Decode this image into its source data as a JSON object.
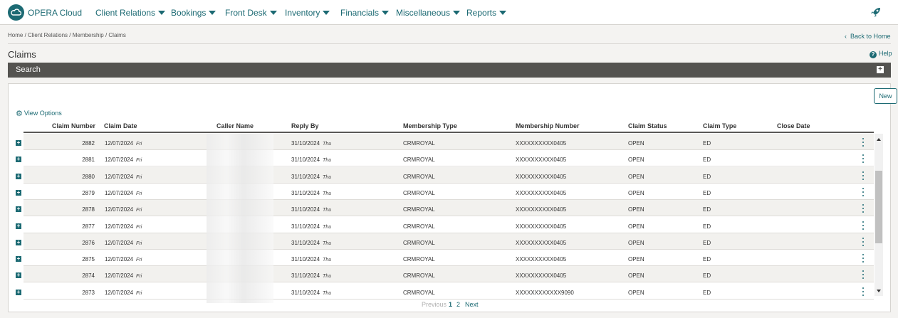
{
  "app": {
    "brand": "OPERA Cloud"
  },
  "nav": [
    {
      "label": "Client Relations"
    },
    {
      "label": "Bookings"
    },
    {
      "label": "Front Desk"
    },
    {
      "label": "Inventory"
    },
    {
      "label": "Financials"
    },
    {
      "label": "Miscellaneous"
    },
    {
      "label": "Reports"
    }
  ],
  "breadcrumb": "Home / Client Relations / Membership / Claims",
  "back_link": "Back to Home",
  "page_title": "Claims",
  "help_label": "Help",
  "search_panel": {
    "label": "Search"
  },
  "new_button": "New",
  "view_options": "View Options",
  "columns": [
    "Claim Number",
    "Claim Date",
    "Caller Name",
    "Reply By",
    "Membership Type",
    "Membership Number",
    "Claim Status",
    "Claim Type",
    "Close Date"
  ],
  "rows": [
    {
      "claim_number": "2882",
      "claim_date": "12/07/2024",
      "claim_day": "Fri",
      "reply_by": "31/10/2024",
      "reply_day": "Thu",
      "membership_type": "CRMROYAL",
      "membership_number": "XXXXXXXXXX0405",
      "status": "OPEN",
      "type": "ED",
      "close_date": ""
    },
    {
      "claim_number": "2881",
      "claim_date": "12/07/2024",
      "claim_day": "Fri",
      "reply_by": "31/10/2024",
      "reply_day": "Thu",
      "membership_type": "CRMROYAL",
      "membership_number": "XXXXXXXXXX0405",
      "status": "OPEN",
      "type": "ED",
      "close_date": ""
    },
    {
      "claim_number": "2880",
      "claim_date": "12/07/2024",
      "claim_day": "Fri",
      "reply_by": "31/10/2024",
      "reply_day": "Thu",
      "membership_type": "CRMROYAL",
      "membership_number": "XXXXXXXXXX0405",
      "status": "OPEN",
      "type": "ED",
      "close_date": ""
    },
    {
      "claim_number": "2879",
      "claim_date": "12/07/2024",
      "claim_day": "Fri",
      "reply_by": "31/10/2024",
      "reply_day": "Thu",
      "membership_type": "CRMROYAL",
      "membership_number": "XXXXXXXXXX0405",
      "status": "OPEN",
      "type": "ED",
      "close_date": ""
    },
    {
      "claim_number": "2878",
      "claim_date": "12/07/2024",
      "claim_day": "Fri",
      "reply_by": "31/10/2024",
      "reply_day": "Thu",
      "membership_type": "CRMROYAL",
      "membership_number": "XXXXXXXXXX0405",
      "status": "OPEN",
      "type": "ED",
      "close_date": ""
    },
    {
      "claim_number": "2877",
      "claim_date": "12/07/2024",
      "claim_day": "Fri",
      "reply_by": "31/10/2024",
      "reply_day": "Thu",
      "membership_type": "CRMROYAL",
      "membership_number": "XXXXXXXXXX0405",
      "status": "OPEN",
      "type": "ED",
      "close_date": ""
    },
    {
      "claim_number": "2876",
      "claim_date": "12/07/2024",
      "claim_day": "Fri",
      "reply_by": "31/10/2024",
      "reply_day": "Thu",
      "membership_type": "CRMROYAL",
      "membership_number": "XXXXXXXXXX0405",
      "status": "OPEN",
      "type": "ED",
      "close_date": ""
    },
    {
      "claim_number": "2875",
      "claim_date": "12/07/2024",
      "claim_day": "Fri",
      "reply_by": "31/10/2024",
      "reply_day": "Thu",
      "membership_type": "CRMROYAL",
      "membership_number": "XXXXXXXXXX0405",
      "status": "OPEN",
      "type": "ED",
      "close_date": ""
    },
    {
      "claim_number": "2874",
      "claim_date": "12/07/2024",
      "claim_day": "Fri",
      "reply_by": "31/10/2024",
      "reply_day": "Thu",
      "membership_type": "CRMROYAL",
      "membership_number": "XXXXXXXXXX0405",
      "status": "OPEN",
      "type": "ED",
      "close_date": ""
    },
    {
      "claim_number": "2873",
      "claim_date": "12/07/2024",
      "claim_day": "Fri",
      "reply_by": "31/10/2024",
      "reply_day": "Thu",
      "membership_type": "CRMROYAL",
      "membership_number": "XXXXXXXXXXXX9090",
      "status": "OPEN",
      "type": "ED",
      "close_date": ""
    }
  ],
  "pagination": {
    "previous": "Previous",
    "pages": [
      "1",
      "2"
    ],
    "current": "1",
    "next": "Next"
  },
  "icons": {
    "logo": "cloud-logo-icon",
    "rocket": "rocket-icon",
    "help": "help-icon",
    "gear": "gear-icon",
    "expand": "plus-icon",
    "row_menu": "kebab-menu-icon"
  },
  "colors": {
    "accent": "#1c6a73",
    "search_bar": "#545350",
    "page_bg": "#f4f3f1",
    "disabled": "#b0b0b0"
  }
}
